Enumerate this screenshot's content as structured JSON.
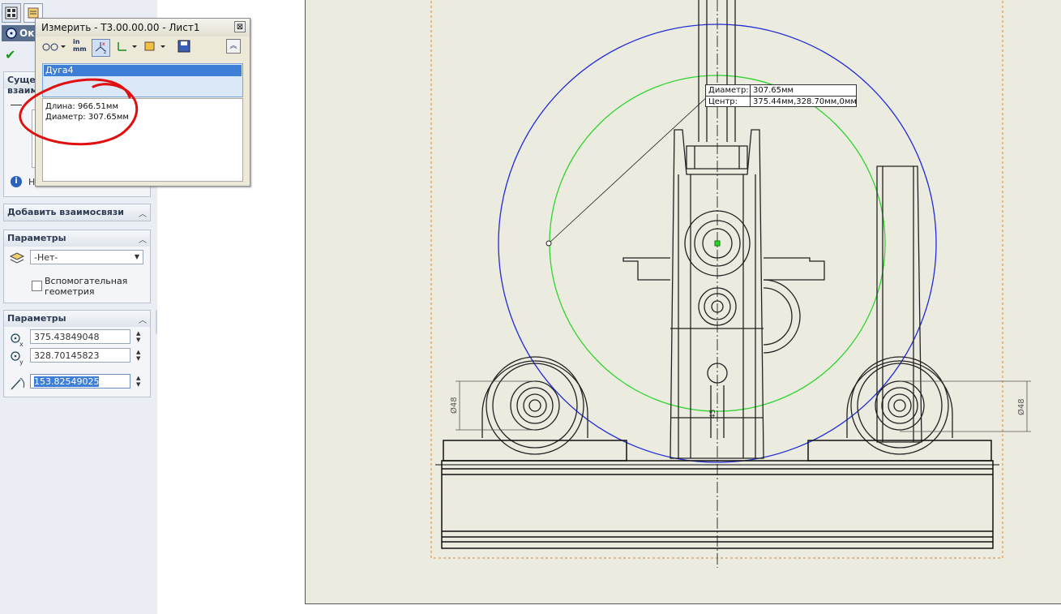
{
  "feature_panel": {
    "title": "Окружность",
    "existing_relations_label": "Существующие взаимосвязи",
    "existing_relations_info": "Нет",
    "add_relations_label": "Добавить взаимосвязи",
    "options_label": "Параметры",
    "layer_value": "-Нет-",
    "construction_label_1": "Вспомогательная",
    "construction_label_2": "геометрия",
    "parameters_label": "Параметры",
    "center_x": "375.43849048",
    "center_y": "328.70145823",
    "radius": "153.82549025"
  },
  "measure_dialog": {
    "title": "Измерить - Т3.00.00.00 - Лист1",
    "toolbar": {
      "units_in": "in",
      "units_mm": "mm"
    },
    "selected_entity": "Дуга4",
    "result_length": "Длина: 966.51мм",
    "result_diameter": "Диаметр: 307.65мм",
    "close_glyph": "⊠"
  },
  "callout": {
    "diameter_label": "Диаметр:",
    "diameter_value": "307.65мм",
    "center_label": "Центр:",
    "center_value": "375.44мм,328.70мм,0мм"
  },
  "drawing": {
    "dim_left": "Ø48",
    "dim_right": "Ø48",
    "dim_center": "45"
  },
  "colors": {
    "sheet_bg": "#ecebdf",
    "circle_blue": "#1f2bd6",
    "circle_green": "#31d331",
    "annotation_red": "#e01010",
    "panel_bg": "#eaeef4"
  }
}
